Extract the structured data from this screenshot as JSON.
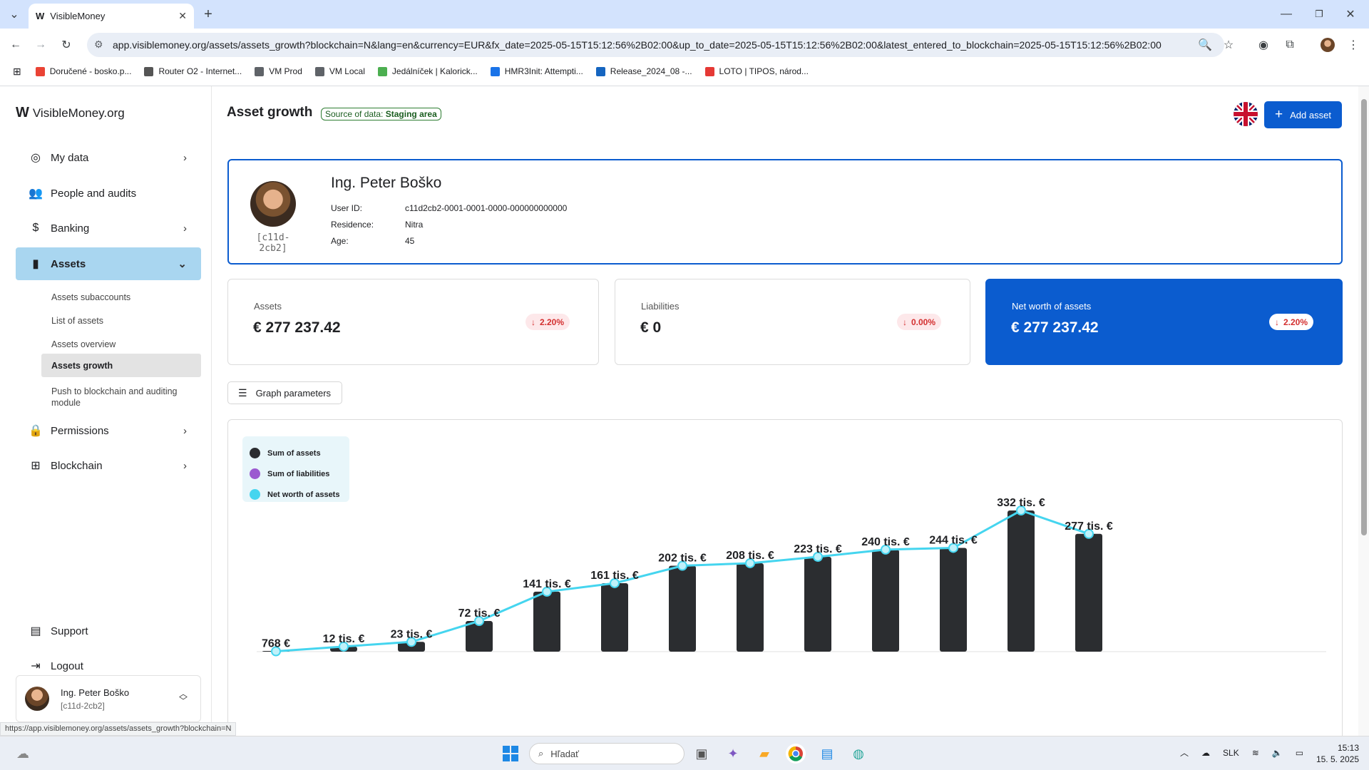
{
  "browser": {
    "tab_title": "VisibleMoney",
    "favicon_text": "W",
    "url": "app.visiblemoney.org/assets/assets_growth?blockchain=N&lang=en&currency=EUR&fx_date=2025-05-15T15:12:56%2B02:00&up_to_date=2025-05-15T15:12:56%2B02:00&latest_entered_to_blockchain=2025-05-15T15:12:56%2B02:00",
    "bookmarks": [
      {
        "label": "Doručené - bosko.p...",
        "icon": "gmail-icon",
        "color": "#ea4335"
      },
      {
        "label": "Router O2 - Internet...",
        "icon": "router-icon",
        "color": "#555555"
      },
      {
        "label": "VM Prod",
        "icon": "folder-icon",
        "color": "#5f6368"
      },
      {
        "label": "VM Local",
        "icon": "folder-icon",
        "color": "#5f6368"
      },
      {
        "label": "Jedálníček | Kalorick...",
        "icon": "kaloricke-icon",
        "color": "#4caf50"
      },
      {
        "label": "HMR3Init: Attempti...",
        "icon": "vs-icon",
        "color": "#1a73e8"
      },
      {
        "label": "Release_2024_08 -...",
        "icon": "jira-icon",
        "color": "#1565c0"
      },
      {
        "label": "LOTO | TIPOS, národ...",
        "icon": "tipos-icon",
        "color": "#e53935"
      }
    ],
    "status_url": "https://app.visiblemoney.org/assets/assets_growth?blockchain=N"
  },
  "sidebar": {
    "logo_mark": "W",
    "logo_text": "VisibleMoney.org",
    "items": [
      {
        "label": "My data",
        "icon": "account-circle-icon",
        "has_chevron": true
      },
      {
        "label": "People and audits",
        "icon": "people-icon",
        "has_chevron": false
      },
      {
        "label": "Banking",
        "icon": "banking-icon",
        "has_chevron": true
      },
      {
        "label": "Assets",
        "icon": "bar-chart-icon",
        "has_chevron": true,
        "active": true
      }
    ],
    "subitems": [
      {
        "label": "Assets subaccounts"
      },
      {
        "label": "List of assets"
      },
      {
        "label": "Assets overview"
      },
      {
        "label": "Assets growth",
        "active": true
      },
      {
        "label": "Push to blockchain and auditing module"
      }
    ],
    "items2": [
      {
        "label": "Permissions",
        "icon": "lock-icon"
      },
      {
        "label": "Blockchain",
        "icon": "grid-icon"
      }
    ],
    "bottom": [
      {
        "label": "Support",
        "icon": "chat-icon"
      },
      {
        "label": "Logout",
        "icon": "logout-icon"
      }
    ],
    "user": {
      "name": "Ing. Peter Boško",
      "id": "[c11d-2cb2]"
    }
  },
  "header": {
    "title": "Asset growth",
    "source_prefix": "Source of data:",
    "source_value": "Staging area",
    "add_button": "Add asset"
  },
  "profile": {
    "name": "Ing. Peter Boško",
    "short_id": "[c11d-2cb2]",
    "fields": [
      {
        "key": "User ID:",
        "value": "c11d2cb2-0001-0001-0000-000000000000"
      },
      {
        "key": "Residence:",
        "value": "Nitra"
      },
      {
        "key": "Age:",
        "value": "45"
      }
    ]
  },
  "cards": [
    {
      "label": "Assets",
      "value": "€ 277 237.42",
      "change": "2.20%"
    },
    {
      "label": "Liabilities",
      "value": "€ 0",
      "change": "0.00%"
    },
    {
      "label": "Net worth of assets",
      "value": "€ 277 237.42",
      "change": "2.20%"
    }
  ],
  "graph_params_label": "Graph parameters",
  "chart_data": {
    "type": "bar",
    "series": [
      {
        "name": "Sum of assets",
        "color": "#2b2d30",
        "values": [
          768,
          12000,
          23000,
          72000,
          141000,
          161000,
          202000,
          208000,
          223000,
          240000,
          244000,
          332000,
          277000
        ]
      },
      {
        "name": "Sum of liabilities",
        "color": "#9b59d0",
        "values": []
      },
      {
        "name": "Net worth of assets",
        "color": "#45d5ef",
        "values": [
          768,
          12000,
          23000,
          72000,
          141000,
          161000,
          202000,
          208000,
          223000,
          240000,
          244000,
          332000,
          277000
        ]
      }
    ],
    "data_labels": [
      "768 €",
      "12 tis. €",
      "23 tis. €",
      "72 tis. €",
      "141 tis. €",
      "161 tis. €",
      "202 tis. €",
      "208 tis. €",
      "223 tis. €",
      "240 tis. €",
      "244 tis. €",
      "332 tis. €",
      "277 tis. €"
    ],
    "ylim": [
      0,
      332000
    ],
    "legend_placement": "top-left",
    "grid": false
  },
  "taskbar": {
    "search_placeholder": "Hľadať",
    "language": "SLK",
    "time": "15:13",
    "date": "15. 5. 2025"
  }
}
